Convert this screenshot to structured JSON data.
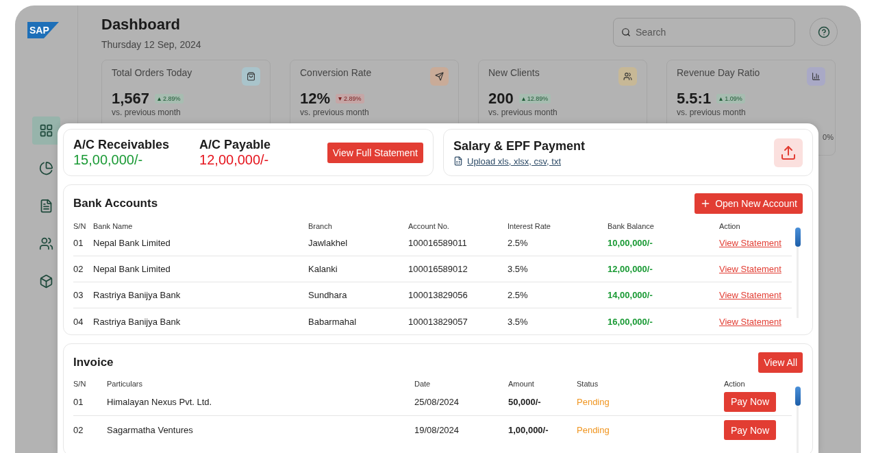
{
  "logo": "SAP",
  "sidebar": {
    "items": [
      {
        "selected": true
      },
      {
        "selected": false
      },
      {
        "selected": false
      },
      {
        "selected": false
      },
      {
        "selected": false
      }
    ]
  },
  "header": {
    "title": "Dashboard",
    "date": "Thursday 12 Sep, 2024"
  },
  "search": {
    "placeholder": "Search"
  },
  "stats": [
    {
      "label": "Total Orders Today",
      "value": "1,567",
      "change": "2.89%",
      "rising": true,
      "note": "vs. previous month",
      "color": "#a9c4cb"
    },
    {
      "label": "Conversion Rate",
      "value": "12%",
      "change": "2.89%",
      "rising": false,
      "note": "vs. previous month",
      "color": "#c9ab98"
    },
    {
      "label": "New Clients",
      "value": "200",
      "change": "12.89%",
      "rising": true,
      "note": "vs. previous month",
      "color": "#c7b896"
    },
    {
      "label": "Revenue Day Ratio",
      "value": "5.5:1",
      "change": "1.09%",
      "rising": true,
      "note": "vs. previous month",
      "color": "#a9a9c6",
      "extra": "0%"
    }
  ],
  "accounts": {
    "receivables": {
      "label": "A/C Receivables",
      "amount": "15,00,000/-"
    },
    "payable": {
      "label": "A/C Payable",
      "amount": "12,00,000/-"
    },
    "button": "View Full Statement"
  },
  "salary": {
    "title": "Salary & EPF Payment",
    "link": "Upload xls, xlsx, csv, txt"
  },
  "bank_accounts": {
    "title": "Bank Accounts",
    "button": "Open New Account",
    "columns": [
      "S/N",
      "Bank Name",
      "Branch",
      "Account No.",
      "Interest Rate",
      "Bank Balance",
      "Action"
    ],
    "rows": [
      {
        "sn": "01",
        "bank": "Nepal Bank Limited",
        "branch": "Jawlakhel",
        "account": "100016589011",
        "rate": "2.5%",
        "balance": "10,00,000/-",
        "action": "View Statement"
      },
      {
        "sn": "02",
        "bank": "Nepal Bank Limited",
        "branch": "Kalanki",
        "account": "100016589012",
        "rate": "3.5%",
        "balance": "12,00,000/-",
        "action": "View Statement"
      },
      {
        "sn": "03",
        "bank": "Rastriya Banijya Bank",
        "branch": "Sundhara",
        "account": "100013829056",
        "rate": "2.5%",
        "balance": "14,00,000/-",
        "action": "View Statement"
      },
      {
        "sn": "04",
        "bank": "Rastriya Banijya Bank",
        "branch": "Babarmahal",
        "account": "100013829057",
        "rate": "3.5%",
        "balance": "16,00,000/-",
        "action": "View Statement"
      }
    ]
  },
  "invoice": {
    "title": "Invoice",
    "button": "View All",
    "columns": [
      "S/N",
      "Particulars",
      "Date",
      "Amount",
      "Status",
      "Action"
    ],
    "rows": [
      {
        "sn": "01",
        "particulars": "Himalayan Nexus Pvt. Ltd.",
        "date": "25/08/2024",
        "amount": "50,000/-",
        "status": "Pending",
        "action": "Pay Now"
      },
      {
        "sn": "02",
        "particulars": "Sagarmatha Ventures",
        "date": "19/08/2024",
        "amount": "1,00,000/-",
        "status": "Pending",
        "action": "Pay Now"
      }
    ]
  }
}
